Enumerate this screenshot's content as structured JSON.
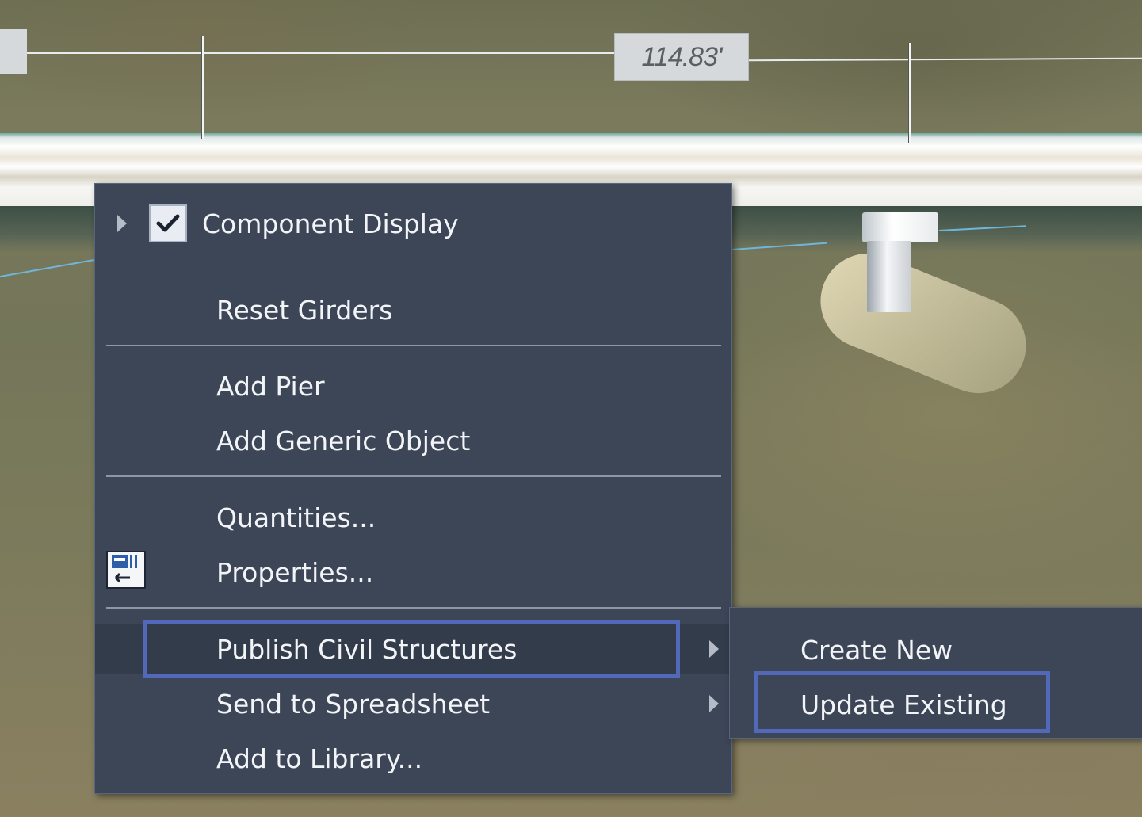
{
  "viewport": {
    "dimension_label": "114.83'"
  },
  "context_menu": {
    "items": [
      {
        "id": "component-display",
        "label": "Component Display",
        "checked": true,
        "has_submenu_left": true
      },
      {
        "id": "reset-girders",
        "label": "Reset Girders"
      },
      {
        "id": "add-pier",
        "label": "Add Pier"
      },
      {
        "id": "add-generic-object",
        "label": "Add Generic Object"
      },
      {
        "id": "quantities",
        "label": "Quantities..."
      },
      {
        "id": "properties",
        "label": "Properties...",
        "icon": "properties-icon"
      },
      {
        "id": "publish-civil-structures",
        "label": "Publish Civil Structures",
        "has_submenu": true,
        "highlighted": true
      },
      {
        "id": "send-to-spreadsheet",
        "label": "Send to Spreadsheet",
        "has_submenu": true
      },
      {
        "id": "add-to-library",
        "label": "Add to Library..."
      }
    ]
  },
  "submenu": {
    "items": [
      {
        "id": "create-new",
        "label": "Create New"
      },
      {
        "id": "update-existing",
        "label": "Update Existing",
        "highlighted": true
      }
    ]
  },
  "colors": {
    "menu_background": "#3c4657",
    "menu_text": "#f2f4f7",
    "highlight_border": "#5268b8",
    "separator": "#8c96a6"
  }
}
